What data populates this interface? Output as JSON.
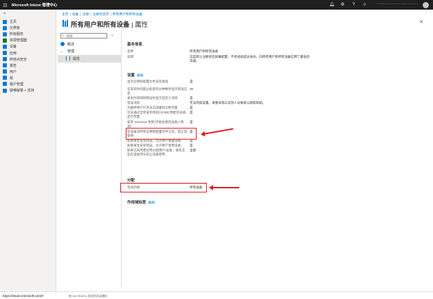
{
  "app": {
    "title": "Microsoft Intune 管理中心",
    "account_text": "..........................................................................",
    "top_icons": [
      "bell-icon",
      "gear-icon",
      "help-icon",
      "feedback-icon"
    ]
  },
  "nav": {
    "items": [
      {
        "label": "主页",
        "icon": "home-icon",
        "color": "#0078d4"
      },
      {
        "label": "仪表板",
        "icon": "dashboard-icon",
        "color": "#0078d4"
      },
      {
        "label": "所有服务",
        "icon": "all-services-icon",
        "color": "#0078d4"
      },
      {
        "label": "资源管理器",
        "icon": "explorer-icon",
        "color": "#107c10"
      },
      {
        "label": "设备",
        "icon": "devices-icon",
        "color": "#0078d4"
      },
      {
        "label": "应用",
        "icon": "apps-icon",
        "color": "#0078d4"
      },
      {
        "label": "终结点安全",
        "icon": "endpoint-security-icon",
        "color": "#0078d4"
      },
      {
        "label": "报告",
        "icon": "reports-icon",
        "color": "#0078d4"
      },
      {
        "label": "用户",
        "icon": "users-icon",
        "color": "#0078d4"
      },
      {
        "label": "组",
        "icon": "groups-icon",
        "color": "#0078d4"
      },
      {
        "label": "租户管理",
        "icon": "tenant-admin-icon",
        "color": "#0078d4"
      },
      {
        "label": "疑难解答 + 支持",
        "icon": "troubleshooting-icon",
        "color": "#0078d4"
      }
    ]
  },
  "breadcrumb": {
    "items": [
      "主页",
      "设备",
      "注册",
      "注册状态页",
      "所有用户和所有设备"
    ],
    "separator": "|"
  },
  "page": {
    "title": "所有用户和所有设备",
    "subtitle": "| 属性",
    "more": "···",
    "close": "✕"
  },
  "resource_menu": {
    "search_placeholder": "搜索",
    "items": [
      {
        "label": "概述",
        "icon": "info-icon"
      },
      {
        "label": "管理",
        "icon": "chevron-down-icon"
      },
      {
        "label": "属性",
        "icon": "properties-icon"
      }
    ]
  },
  "basic_info": {
    "title": "基本信息",
    "name_label": "名称",
    "name_value": "所有用户和所有设备",
    "desc_label": "说明",
    "desc_value": "这是默认注册状态屏幕配置，不考虑组成员身份，向所有用户和所有设备应用了最低优先级。"
  },
  "settings": {
    "title": "设置",
    "edit": "编辑",
    "rows": [
      {
        "label": "显示应用和配置文件安装进度",
        "value": "是"
      },
      {
        "label": "在安装时间超过指定的分钟数时显示错误信息",
        "value": "30"
      },
      {
        "label": "发生时间限制错误时显示自定义消息",
        "value": "是"
      },
      {
        "label": "错误消息",
        "value": "无法完成设置。请重试或与支持人员联系以获取帮助。"
      },
      {
        "label": "为最终用户打开日志收集和诊断页面",
        "value": "是"
      },
      {
        "label": "仅向通过全新安装体验(OOBE)预配的设备显示页面",
        "value": "是"
      },
      {
        "label": "安装 Windows 更新(可能会重启设备) (预览)",
        "value": "是"
      },
      {
        "label": "在设备对所有应用和配置文件之前，阻止其使用",
        "value": "是"
      },
      {
        "label": "如果发生安装错误，允许用户重置设备",
        "value": "是"
      },
      {
        "label": "如果发生安装错误，允许用户使用设备",
        "value": "是"
      },
      {
        "label": "如果已向所需应用分配用户/设备，请在这些在设备完毕前止设备使用",
        "value": "全部"
      }
    ]
  },
  "assignments": {
    "title": "分配",
    "label": "包含的组",
    "value": "所有设备"
  },
  "scope_tags": {
    "title": "作用域标签",
    "edit": "编辑",
    "value": "-"
  },
  "statusbar": {
    "url": "https://intune.microsoft.com/#",
    "hint": "按 Ctrl+Shift+A 添加到活动通知"
  },
  "colors": {
    "accent": "#0078d4",
    "highlight": "#e01e25",
    "topbar": "#1f1f1f"
  }
}
